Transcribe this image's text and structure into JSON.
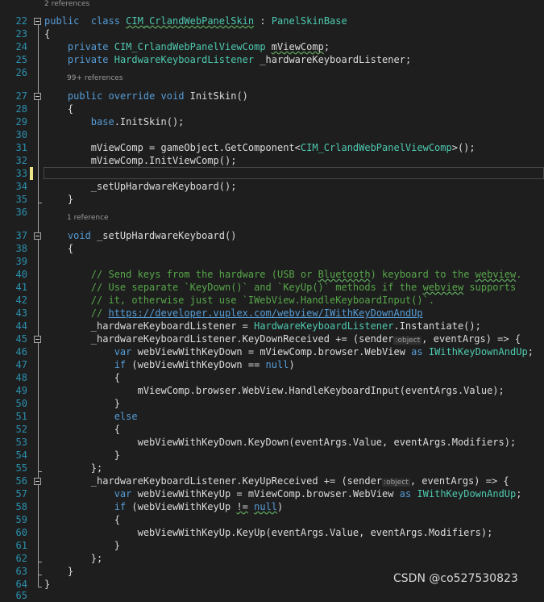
{
  "code_lens": [
    {
      "id": "lens-class",
      "text": "2 references"
    },
    {
      "id": "lens-initskin",
      "text": "99+ references"
    },
    {
      "id": "lens-setup",
      "text": "1 reference"
    }
  ],
  "inlay_hint": ":object",
  "current_line": "33",
  "lines": [
    {
      "n": "22",
      "t": [
        [
          "kw",
          "public"
        ],
        [
          "",
          "  "
        ],
        [
          "kw",
          "class"
        ],
        [
          "",
          " "
        ],
        [
          "ty_sq",
          "CIM_CrlandWebPanelSkin"
        ],
        [
          "",
          " : "
        ],
        [
          "ty",
          "PanelSkinBase"
        ]
      ]
    },
    {
      "n": "23",
      "t": [
        [
          "",
          "{"
        ]
      ]
    },
    {
      "n": "24",
      "t": [
        [
          "",
          "    "
        ],
        [
          "kw",
          "private"
        ],
        [
          "",
          " "
        ],
        [
          "ty",
          "CIM_CrlandWebPanelViewComp"
        ],
        [
          "",
          " "
        ],
        [
          "sq",
          "mViewComp"
        ],
        [
          "",
          ";"
        ]
      ]
    },
    {
      "n": "25",
      "t": [
        [
          "",
          "    "
        ],
        [
          "kw",
          "private"
        ],
        [
          "",
          " "
        ],
        [
          "ty",
          "HardwareKeyboardListener"
        ],
        [
          "",
          " _hardwareKeyboardListener;"
        ]
      ]
    },
    {
      "n": "26",
      "t": []
    },
    {
      "n": "27",
      "t": [
        [
          "",
          "    "
        ],
        [
          "kw",
          "public"
        ],
        [
          "",
          " "
        ],
        [
          "kw",
          "override"
        ],
        [
          "",
          " "
        ],
        [
          "kw",
          "void"
        ],
        [
          "",
          " InitSkin()"
        ]
      ]
    },
    {
      "n": "28",
      "t": [
        [
          "",
          "    {"
        ]
      ]
    },
    {
      "n": "29",
      "t": [
        [
          "",
          "        "
        ],
        [
          "kw",
          "base"
        ],
        [
          "",
          ".InitSkin();"
        ]
      ]
    },
    {
      "n": "30",
      "t": []
    },
    {
      "n": "31",
      "t": [
        [
          "",
          "        mViewComp = gameObject.GetComponent<"
        ],
        [
          "ty",
          "CIM_CrlandWebPanelViewComp"
        ],
        [
          "",
          ">();"
        ]
      ]
    },
    {
      "n": "32",
      "t": [
        [
          "",
          "        mViewComp.InitViewComp();"
        ]
      ]
    },
    {
      "n": "33",
      "t": []
    },
    {
      "n": "34",
      "t": [
        [
          "",
          "        _setUpHardwareKeyboard();"
        ]
      ]
    },
    {
      "n": "35",
      "t": [
        [
          "",
          "    }"
        ]
      ]
    },
    {
      "n": "36",
      "t": []
    },
    {
      "n": "37",
      "t": [
        [
          "",
          "    "
        ],
        [
          "kw",
          "void"
        ],
        [
          "",
          " _setUpHardwareKeyboard()"
        ]
      ]
    },
    {
      "n": "38",
      "t": [
        [
          "",
          "    {"
        ]
      ]
    },
    {
      "n": "39",
      "t": []
    },
    {
      "n": "40",
      "t": [
        [
          "",
          "        "
        ],
        [
          "cm",
          "// Send keys from the hardware (USB or "
        ],
        [
          "cm_sq",
          "Bluetooth"
        ],
        [
          "cm",
          ") keyboard to the "
        ],
        [
          "cm_sq",
          "webview"
        ],
        [
          "cm",
          "."
        ]
      ]
    },
    {
      "n": "41",
      "t": [
        [
          "",
          "        "
        ],
        [
          "cm",
          "// Use separate `KeyDown()` and `KeyUp()` methods if the "
        ],
        [
          "cm_sq",
          "webview"
        ],
        [
          "cm",
          " supports"
        ]
      ]
    },
    {
      "n": "42",
      "t": [
        [
          "",
          "        "
        ],
        [
          "cm",
          "// it, otherwise just use `IWebView.HandleKeyboardInput()`."
        ]
      ]
    },
    {
      "n": "43",
      "t": [
        [
          "",
          "        "
        ],
        [
          "cm",
          "// "
        ],
        [
          "url",
          "https://developer.vuplex.com/webview/IWithKeyDownAndUp"
        ]
      ]
    },
    {
      "n": "44",
      "t": [
        [
          "",
          "        _hardwareKeyboardListener = "
        ],
        [
          "ty",
          "HardwareKeyboardListener"
        ],
        [
          "",
          ".Instantiate();"
        ]
      ]
    },
    {
      "n": "45",
      "t": [
        [
          "",
          "        _hardwareKeyboardListener.KeyDownReceived += (sender"
        ],
        [
          "inlay",
          ":object"
        ],
        [
          "",
          ", eventArgs) => {"
        ]
      ]
    },
    {
      "n": "46",
      "t": [
        [
          "",
          "            "
        ],
        [
          "kw",
          "var"
        ],
        [
          "",
          " webViewWithKeyDown = mViewComp.browser.WebView "
        ],
        [
          "kw",
          "as"
        ],
        [
          "",
          " "
        ],
        [
          "ty",
          "IWithKeyDownAndUp"
        ],
        [
          "",
          ";"
        ]
      ]
    },
    {
      "n": "47",
      "t": [
        [
          "",
          "            "
        ],
        [
          "kw",
          "if"
        ],
        [
          "",
          " (webViewWithKeyDown == "
        ],
        [
          "kw",
          "null"
        ],
        [
          "",
          ")"
        ]
      ]
    },
    {
      "n": "48",
      "t": [
        [
          "",
          "            {"
        ]
      ]
    },
    {
      "n": "49",
      "t": [
        [
          "",
          "                mViewComp.browser.WebView.HandleKeyboardInput(eventArgs.Value);"
        ]
      ]
    },
    {
      "n": "50",
      "t": [
        [
          "",
          "            }"
        ]
      ]
    },
    {
      "n": "51",
      "t": [
        [
          "",
          "            "
        ],
        [
          "kw",
          "else"
        ]
      ]
    },
    {
      "n": "52",
      "t": [
        [
          "",
          "            {"
        ]
      ]
    },
    {
      "n": "53",
      "t": [
        [
          "",
          "                webViewWithKeyDown.KeyDown(eventArgs.Value, eventArgs.Modifiers);"
        ]
      ]
    },
    {
      "n": "54",
      "t": [
        [
          "",
          "            }"
        ]
      ]
    },
    {
      "n": "55",
      "t": [
        [
          "",
          "        };"
        ]
      ]
    },
    {
      "n": "56",
      "t": [
        [
          "",
          "        _hardwareKeyboardListener.KeyUpReceived += (sender"
        ],
        [
          "inlay",
          ":object"
        ],
        [
          "",
          ", eventArgs) => {"
        ]
      ]
    },
    {
      "n": "57",
      "t": [
        [
          "",
          "            "
        ],
        [
          "kw",
          "var"
        ],
        [
          "",
          " webViewWithKeyUp = mViewComp.browser.WebView "
        ],
        [
          "kw",
          "as"
        ],
        [
          "",
          " "
        ],
        [
          "ty",
          "IWithKeyDownAndUp"
        ],
        [
          "",
          ";"
        ]
      ]
    },
    {
      "n": "58",
      "t": [
        [
          "",
          "            "
        ],
        [
          "kw",
          "if"
        ],
        [
          "",
          " (webViewWithKeyUp "
        ],
        [
          "sq",
          "!="
        ],
        [
          "",
          " "
        ],
        [
          "kw_sq",
          "null"
        ],
        [
          "",
          ")"
        ]
      ]
    },
    {
      "n": "59",
      "t": [
        [
          "",
          "            {"
        ]
      ]
    },
    {
      "n": "60",
      "t": [
        [
          "",
          "                webViewWithKeyUp.KeyUp(eventArgs.Value, eventArgs.Modifiers);"
        ]
      ]
    },
    {
      "n": "61",
      "t": [
        [
          "",
          "            }"
        ]
      ]
    },
    {
      "n": "62",
      "t": [
        [
          "",
          "        };"
        ]
      ]
    },
    {
      "n": "63",
      "t": [
        [
          "",
          "    }"
        ]
      ]
    },
    {
      "n": "64",
      "t": [
        [
          "",
          "}"
        ]
      ]
    },
    {
      "n": "65",
      "t": []
    }
  ],
  "watermark": "CSDN @co527530823",
  "colors": {
    "background": "#1e1e1e",
    "text": "#dcdcdc",
    "keyword": "#569cd6",
    "type": "#4ec9b0",
    "comment": "#57a64a",
    "line_number": "#2b91af",
    "change_indicator": "#efe68a"
  }
}
